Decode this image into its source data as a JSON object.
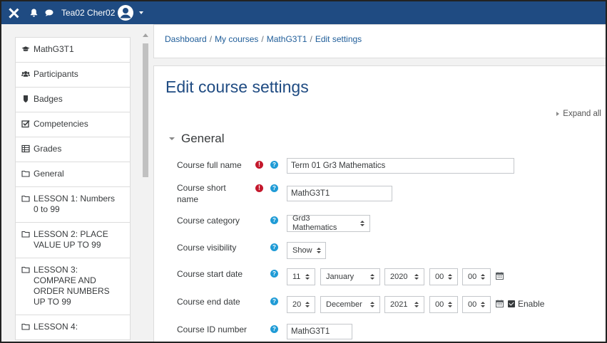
{
  "navbar": {
    "user_name": "Tea02 Cher02",
    "icons": [
      "close-icon",
      "bell-icon",
      "chat-icon",
      "user-avatar-icon",
      "caret-down-icon"
    ]
  },
  "sidebar": {
    "items": [
      {
        "label": "MathG3T1",
        "icon": "graduation-cap-icon"
      },
      {
        "label": "Participants",
        "icon": "users-icon"
      },
      {
        "label": "Badges",
        "icon": "shield-icon"
      },
      {
        "label": "Competencies",
        "icon": "checkbox-icon"
      },
      {
        "label": "Grades",
        "icon": "table-icon"
      },
      {
        "label": "General",
        "icon": "folder-icon"
      },
      {
        "label": "LESSON 1: Numbers\n0 to 99",
        "icon": "folder-icon"
      },
      {
        "label": "LESSON 2: PLACE\nVALUE UP TO 99",
        "icon": "folder-icon"
      },
      {
        "label": "LESSON 3:\nCOMPARE AND\nORDER NUMBERS\nUP TO 99",
        "icon": "folder-icon"
      },
      {
        "label": "LESSON 4:",
        "icon": "folder-icon"
      }
    ]
  },
  "breadcrumb": {
    "items": [
      "Dashboard",
      "My courses",
      "MathG3T1",
      "Edit settings"
    ],
    "separator": "/"
  },
  "page": {
    "title": "Edit course settings",
    "expand_all": "Expand all",
    "section_title": "General"
  },
  "form": {
    "full_name": {
      "label": "Course full name",
      "value": "Term 01 Gr3 Mathematics"
    },
    "short_name": {
      "label": "Course short\nname",
      "value": "MathG3T1"
    },
    "category": {
      "label": "Course category",
      "value": "Grd3 Mathematics"
    },
    "visibility": {
      "label": "Course visibility",
      "value": "Show"
    },
    "start_date": {
      "label": "Course start date",
      "day": "11",
      "month": "January",
      "year": "2020",
      "hour": "00",
      "minute": "00"
    },
    "end_date": {
      "label": "Course end date",
      "day": "20",
      "month": "December",
      "year": "2021",
      "hour": "00",
      "minute": "00",
      "enable_label": "Enable",
      "enabled": true
    },
    "id_number": {
      "label": "Course ID number",
      "value": "MathG3T1"
    }
  },
  "colors": {
    "navbar": "#1f4b82",
    "link": "#1f5d99",
    "required": "#c4182c",
    "help": "#1f9bd6"
  }
}
